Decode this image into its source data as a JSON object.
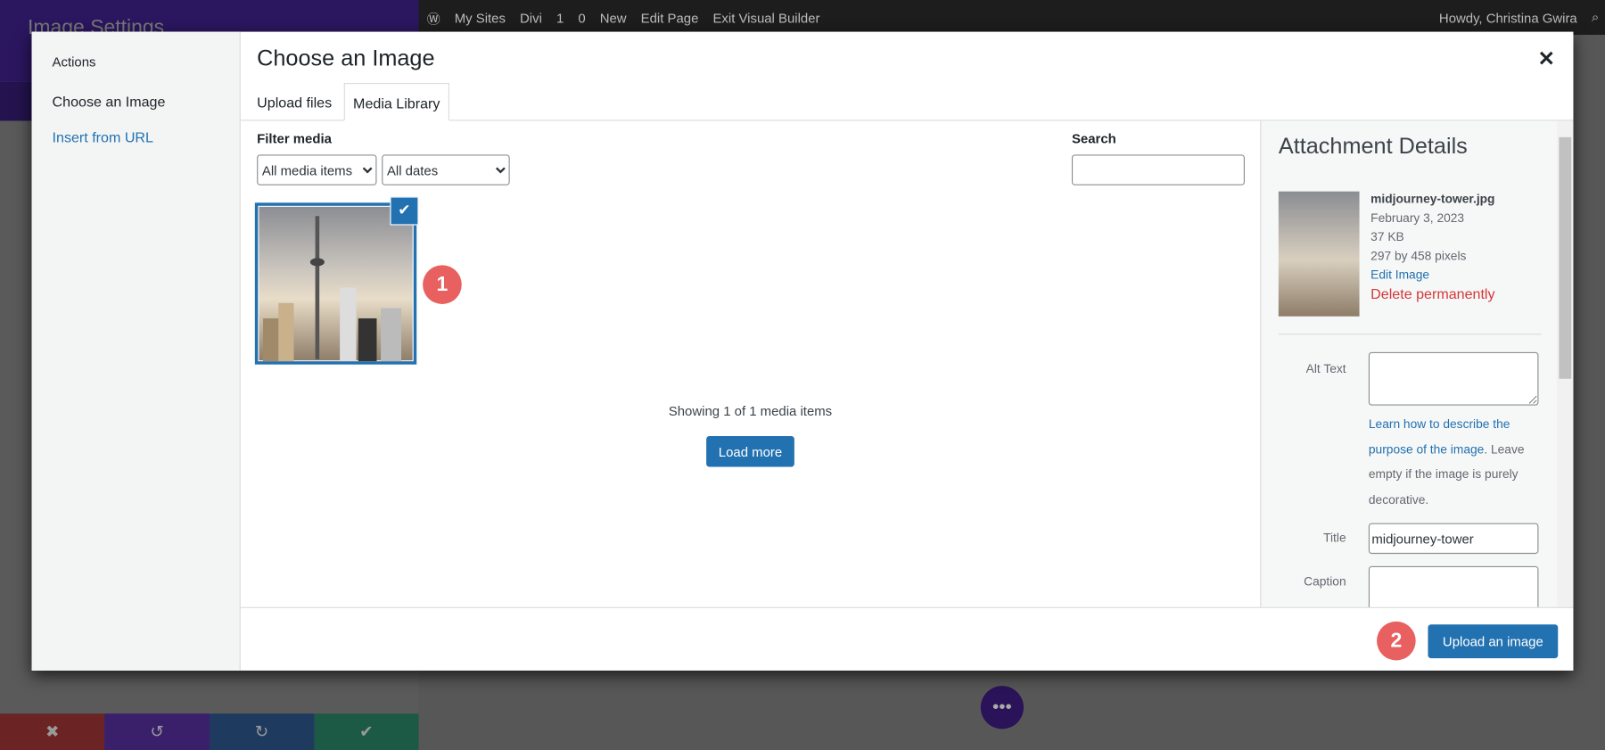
{
  "admin_bar": {
    "items": [
      "My Sites",
      "Divi",
      "1",
      "0",
      "New",
      "Edit Page",
      "Exit Visual Builder"
    ],
    "greeting": "Howdy, Christina Gwira"
  },
  "divi": {
    "panel_title": "Image Settings"
  },
  "modal": {
    "menu": {
      "heading": "Actions",
      "items": [
        "Choose an Image",
        "Insert from URL"
      ]
    },
    "title": "Choose an Image",
    "tabs": [
      "Upload files",
      "Media Library"
    ],
    "filter_label": "Filter media",
    "filter_type": "All media items",
    "filter_date": "All dates",
    "search_label": "Search",
    "search_value": "",
    "showing": "Showing 1 of 1 media items",
    "load_more": "Load more",
    "badges": [
      "1",
      "2"
    ],
    "details": {
      "heading": "Attachment Details",
      "filename": "midjourney-tower.jpg",
      "date": "February 3, 2023",
      "size": "37 KB",
      "dimensions": "297 by 458 pixels",
      "edit": "Edit Image",
      "delete": "Delete permanently",
      "alt_label": "Alt Text",
      "alt_value": "",
      "alt_help_link": "Learn how to describe the purpose of the image",
      "alt_help_rest": ". Leave empty if the image is purely decorative.",
      "title_label": "Title",
      "title_value": "midjourney-tower",
      "caption_label": "Caption",
      "caption_value": ""
    },
    "primary_button": "Upload an image"
  },
  "colors": {
    "accent": "#2271b1",
    "badge": "#e8605f",
    "delete": "#d63638"
  }
}
